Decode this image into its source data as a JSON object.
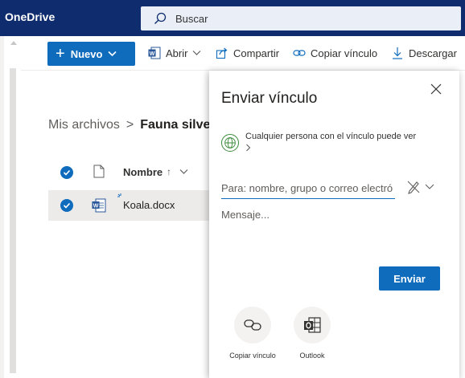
{
  "app": {
    "title": "OneDrive"
  },
  "search": {
    "placeholder": "Buscar"
  },
  "toolbar": {
    "new_label": "Nuevo",
    "open_label": "Abrir",
    "share_label": "Compartir",
    "copy_link_label": "Copiar vínculo",
    "download_label": "Descargar"
  },
  "breadcrumb": {
    "root": "Mis archivos",
    "separator": ">",
    "current": "Fauna silve"
  },
  "list": {
    "header_name": "Nombre",
    "sort_indicator": "↑",
    "rows": [
      {
        "name": "Koala.docx",
        "selected": true
      }
    ]
  },
  "panel": {
    "title": "Enviar vínculo",
    "permission_text": "Cualquier persona con el vínculo puede ver",
    "to_placeholder": "Para: nombre, grupo o correo electró",
    "message_placeholder": "Mensaje...",
    "send_label": "Enviar",
    "options": [
      {
        "label": "Copiar vínculo",
        "icon": "link-icon"
      },
      {
        "label": "Outlook",
        "icon": "outlook-icon"
      }
    ]
  },
  "colors": {
    "topbar": "#0f2d6e",
    "accent": "#0f6cbd",
    "selected_row": "#edebe9",
    "globe": "#3a8a3a"
  }
}
